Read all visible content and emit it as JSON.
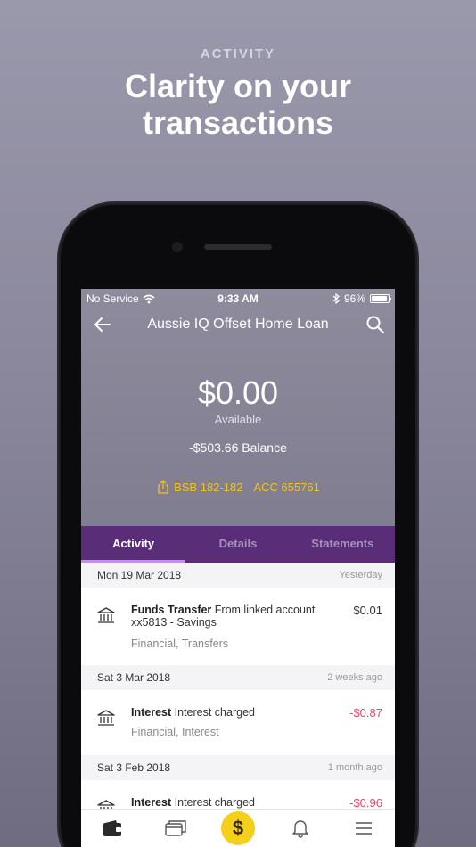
{
  "hero": {
    "kicker": "ACTIVITY",
    "title_line1": "Clarity on your",
    "title_line2": "transactions"
  },
  "status_bar": {
    "carrier": "No Service",
    "time": "9:33 AM",
    "battery": "96%",
    "battery_level": 0.96
  },
  "nav": {
    "title": "Aussie IQ Offset Home Loan",
    "back_icon": "arrow-left-icon",
    "search_icon": "search-icon"
  },
  "account": {
    "amount": "$0.00",
    "available_label": "Available",
    "balance": "-$503.66 Balance",
    "bsb": "BSB 182-182",
    "acc": "ACC 655761",
    "share_icon": "share-icon"
  },
  "tabs": [
    {
      "label": "Activity",
      "active": true
    },
    {
      "label": "Details",
      "active": false
    },
    {
      "label": "Statements",
      "active": false
    }
  ],
  "groups": [
    {
      "date": "Mon 19 Mar 2018",
      "relative": "Yesterday",
      "transactions": [
        {
          "title": "Funds Transfer",
          "desc_line1": "From linked account",
          "desc_line2": "xx5813 - Savings",
          "category": "Financial, Transfers",
          "amount": "$0.01",
          "negative": false,
          "icon": "bank-icon"
        }
      ]
    },
    {
      "date": "Sat 3 Mar 2018",
      "relative": "2 weeks ago",
      "transactions": [
        {
          "title": "Interest",
          "desc_line1": "Interest charged",
          "desc_line2": "",
          "category": "Financial, Interest",
          "amount": "-$0.87",
          "negative": true,
          "icon": "bank-icon"
        }
      ]
    },
    {
      "date": "Sat 3 Feb 2018",
      "relative": "1 month ago",
      "transactions": [
        {
          "title": "Interest",
          "desc_line1": "Interest charged",
          "desc_line2": "",
          "category": "",
          "amount": "-$0.96",
          "negative": true,
          "icon": "bank-icon"
        }
      ]
    }
  ],
  "tabbar": {
    "items": [
      "wallet-icon",
      "cards-icon",
      "dollar-icon",
      "bell-icon",
      "menu-icon"
    ],
    "center_symbol": "$"
  },
  "colors": {
    "accent": "#5a2d78",
    "highlight": "#f2c418",
    "negative": "#d94a6a"
  }
}
